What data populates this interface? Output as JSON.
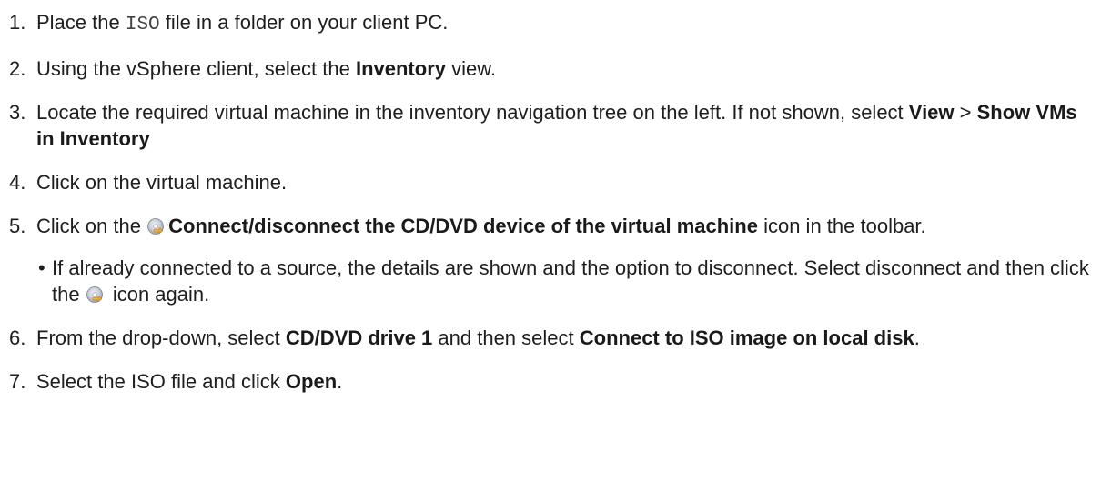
{
  "steps": [
    {
      "num": "1.",
      "t1": "Place the ",
      "code": "ISO",
      "t2": " file in a folder on your client PC."
    },
    {
      "num": "2.",
      "t1": "Using the vSphere client, select the ",
      "b1": "Inventory",
      "t2": " view."
    },
    {
      "num": "3.",
      "t1": "Locate the required virtual machine in the inventory navigation tree on the left. If not shown, select ",
      "b1": "View",
      "t2": " > ",
      "b2": "Show VMs in Inventory"
    },
    {
      "num": "4.",
      "t1": "Click on the virtual machine."
    },
    {
      "num": "5.",
      "t1": "Click on the ",
      "b1": "Connect/disconnect the CD/DVD device of the virtual machine",
      "t2": " icon in the toolbar.",
      "sub": {
        "bullet": "•",
        "t1": "If already connected to a source, the details are shown and the option to disconnect. Select disconnect and then click the ",
        "t2": " icon again."
      }
    },
    {
      "num": "6.",
      "t1": "From the drop-down, select ",
      "b1": "CD/DVD drive 1",
      "t2": " and then select ",
      "b2": "Connect to ISO image on local disk",
      "t3": "."
    },
    {
      "num": "7.",
      "t1": "Select the ISO file and click ",
      "b1": "Open",
      "t2": "."
    }
  ],
  "icons": {
    "cd_connect": "cd-dvd-connect-icon"
  }
}
